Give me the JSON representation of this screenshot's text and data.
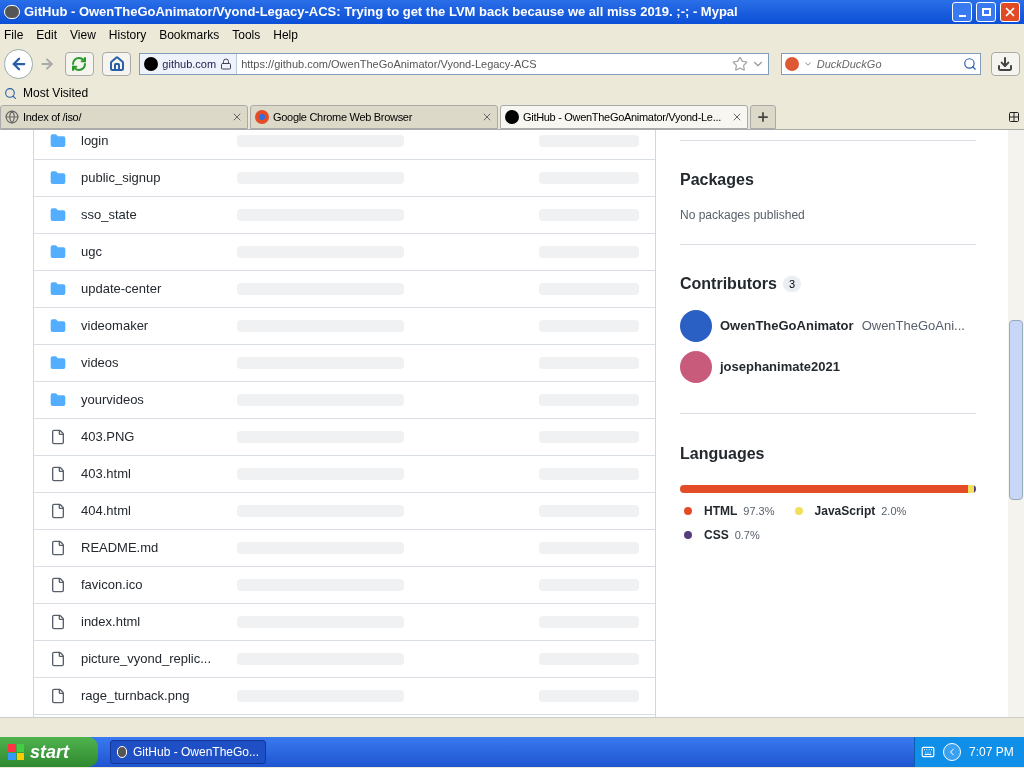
{
  "window": {
    "title": "GitHub - OwenTheGoAnimator/Vyond-Legacy-ACS: Trying to get the LVM back because we all miss 2019. ;-; - Mypal"
  },
  "menu": [
    "File",
    "Edit",
    "View",
    "History",
    "Bookmarks",
    "Tools",
    "Help"
  ],
  "navbar": {
    "site": "github.com",
    "url": "https://github.com/OwenTheGoAnimator/Vyond-Legacy-ACS",
    "search_placeholder": "DuckDuckGo"
  },
  "bookmarks": [
    "Most Visited"
  ],
  "tabs": [
    {
      "label": "Index of /iso/",
      "selected": false
    },
    {
      "label": "Google Chrome Web Browser",
      "selected": false
    },
    {
      "label": "GitHub - OwenTheGoAnimator/Vyond-Le...",
      "selected": true
    }
  ],
  "files": [
    {
      "name": "login",
      "kind": "folder"
    },
    {
      "name": "public_signup",
      "kind": "folder"
    },
    {
      "name": "sso_state",
      "kind": "folder"
    },
    {
      "name": "ugc",
      "kind": "folder"
    },
    {
      "name": "update-center",
      "kind": "folder"
    },
    {
      "name": "videomaker",
      "kind": "folder"
    },
    {
      "name": "videos",
      "kind": "folder"
    },
    {
      "name": "yourvideos",
      "kind": "folder"
    },
    {
      "name": "403.PNG",
      "kind": "file"
    },
    {
      "name": "403.html",
      "kind": "file"
    },
    {
      "name": "404.html",
      "kind": "file"
    },
    {
      "name": "README.md",
      "kind": "file"
    },
    {
      "name": "favicon.ico",
      "kind": "file"
    },
    {
      "name": "index.html",
      "kind": "file"
    },
    {
      "name": "picture_vyond_replic...",
      "kind": "file"
    },
    {
      "name": "rage_turnback.png",
      "kind": "file"
    }
  ],
  "sidebar": {
    "packages": {
      "title": "Packages",
      "text": "No packages published"
    },
    "contributors": {
      "title": "Contributors",
      "count": "3",
      "people": [
        {
          "login": "OwenTheGoAnimator",
          "name": "OwenTheGoAni...",
          "color": "#2a5fc4"
        },
        {
          "login": "josephanimate2021",
          "color": "#c85a7c"
        }
      ]
    },
    "languages": {
      "title": "Languages",
      "items": [
        {
          "name": "HTML",
          "percent": "97.3%",
          "level": 0.973,
          "color": "#e34c26"
        },
        {
          "name": "JavaScript",
          "percent": "2.0%",
          "level": 0.02,
          "color": "#f1e05a"
        },
        {
          "name": "CSS",
          "percent": "0.7%",
          "level": 0.007,
          "color": "#563d7c"
        }
      ]
    }
  },
  "taskbar": {
    "start": "start",
    "windows": [
      "GitHub - OwenTheGo..."
    ],
    "clock": "7:07 PM"
  }
}
